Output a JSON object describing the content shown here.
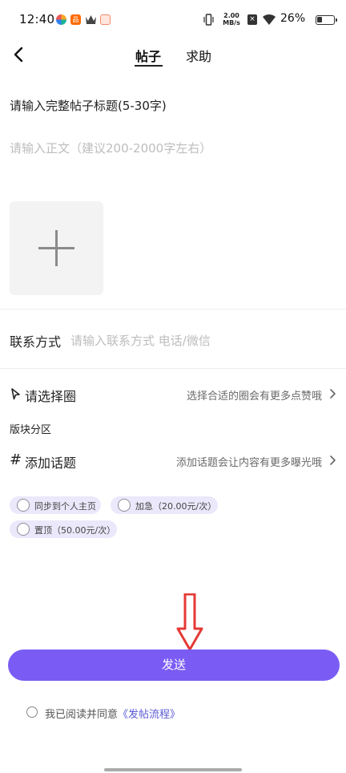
{
  "status_bar": {
    "time": "12:40",
    "net_speed": "2.00\nMB/s",
    "battery": "26%"
  },
  "nav": {
    "tabs": [
      {
        "label": "帖子",
        "active": true
      },
      {
        "label": "求助",
        "active": false
      }
    ]
  },
  "form": {
    "title_placeholder": "请输入完整帖子标题(5-30字)",
    "body_placeholder": "请输入正文（建议200-2000字左右）",
    "contact_label": "联系方式",
    "contact_placeholder": "请输入联系方式 电话/微信",
    "circle_label": "请选择圈",
    "circle_hint": "选择合适的圈会有更多点赞哦",
    "section_label": "版块分区",
    "topic_label": "添加话题",
    "topic_hint": "添加话题会让内容有更多曝光哦",
    "options": [
      {
        "label": "同步到个人主页"
      },
      {
        "label": "加急（20.00元/次）"
      },
      {
        "label": "置顶（50.00元/次）"
      }
    ]
  },
  "actions": {
    "send_label": "发送",
    "agree_prefix": "我已阅读并同意",
    "agree_link": "《发帖流程》"
  },
  "colors": {
    "accent": "#7a5cf4",
    "option_bg": "#ece8fb",
    "annotation_arrow": "#e53935"
  },
  "icons": [
    "back-icon",
    "plus-icon",
    "navigation-arrow-icon",
    "hash-icon",
    "chevron-right-icon"
  ]
}
